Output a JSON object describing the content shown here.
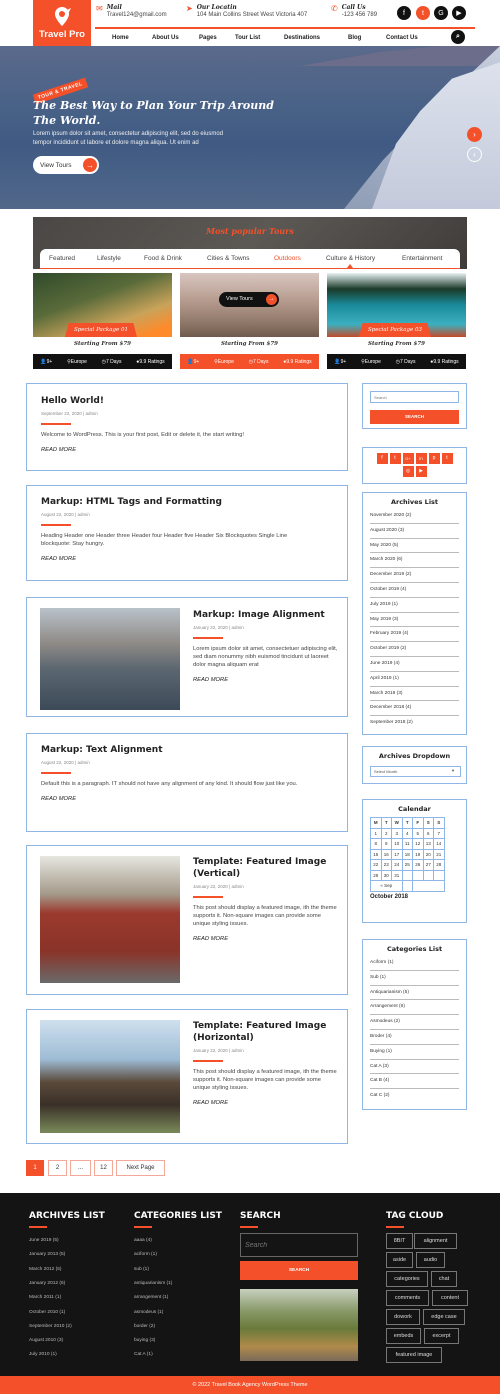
{
  "header": {
    "brand": "Travel Pro",
    "mail_label": "Mail",
    "mail_value": "Travel124@gmail.com",
    "location_label": "Our Locatin",
    "location_value": "104 Main Collins Street West Victoria 407",
    "call_label": "Call Us",
    "call_value": "-123 456 789",
    "social": [
      "facebook",
      "twitter",
      "google",
      "youtube"
    ],
    "nav": [
      "Home",
      "About Us",
      "Pages",
      "Tour List",
      "Destinations",
      "Blog",
      "Contact Us"
    ]
  },
  "hero": {
    "tag": "TOUR & TRAVEL",
    "title": "The Best Way to Plan Your Trip Around The World.",
    "text": "Lorem ipsum dolor sit amet, consectetur adipiscing elit, sed do eiusmod tempor incididunt ut labore et dolore magna aliqua. Ut enim ad",
    "button": "View Tours"
  },
  "tours": {
    "heading": "Most popular Tours",
    "tabs": [
      "Featured",
      "Lifestyle",
      "Food & Drink",
      "Cities & Towns",
      "Outdoors",
      "Culture & History",
      "Entertainment"
    ],
    "active_tab": "Outdoors",
    "cards": [
      {
        "package": "Special Package 01",
        "price": "Starting From $79",
        "people": "9+",
        "place": "Europe",
        "days": "7 Days",
        "rating": "9.9 Ratings"
      },
      {
        "package": "",
        "price": "Starting From $79",
        "people": "9+",
        "place": "Europe",
        "days": "7 Days",
        "rating": "9.9 Ratings",
        "hover_button": "View Tours"
      },
      {
        "package": "Special Package 03",
        "price": "Starting From $79",
        "people": "9+",
        "place": "Europe",
        "days": "7 Days",
        "rating": "9.9 Ratings"
      }
    ]
  },
  "posts": [
    {
      "title": "Hello World!",
      "meta": "September 22, 2020 | admin",
      "excerpt": "Welcome to WordPress. This is your first post, Edit or delete it, the start writing!",
      "more": "READ MORE"
    },
    {
      "title": "Markup: HTML Tags and Formatting",
      "meta": "August 22, 2020 | admin",
      "excerpt": "Heading Header one Header three Header four Header five Header Six Blockquotes Single Line blockquote: Stay hungry.",
      "more": "READ MORE"
    },
    {
      "title": "Markup: Image Alignment",
      "meta": "January 22, 2020 | admin",
      "excerpt": "Lorem ipsum dolor sit amet, consectetuer adipiscing elit, sed diam nonummy nibh euismod tincidunt ut laoreet dolor magna aliquam erat",
      "more": "READ MORE"
    },
    {
      "title": "Markup: Text Alignment",
      "meta": "August 22, 2020 | admin",
      "excerpt": "Default this is a paragraph. IT should not have any alignment of any kind. It should flow just like you.",
      "more": "READ MORE"
    },
    {
      "title": "Template: Featured Image (Vertical)",
      "meta": "January 22, 2020 | admin",
      "excerpt": "This post should display a featured image, ith the theme supports it. Non-square images can provide some unique styling issues.",
      "more": "READ MORE"
    },
    {
      "title": "Template: Featured Image (Horizontal)",
      "meta": "January 22, 2020 | admin",
      "excerpt": "This post should display a featured image, ith the theme supports it. Non-square images can provide some unique styling issues.",
      "more": "READ MORE"
    }
  ],
  "pagination": [
    "1",
    "2",
    "...",
    "12",
    "Next Page"
  ],
  "sidebar": {
    "search_placeholder": "Search",
    "search_button": "SEARCH",
    "social": [
      "f",
      "t",
      "G+",
      "in",
      "p",
      "t",
      "ig",
      "yt"
    ],
    "archives_title": "Archives List",
    "archives": [
      "November 2020 (2)",
      "August 2020 (3)",
      "May 2020 (5)",
      "March 2020 (6)",
      "December 2019 (2)",
      "October 2019 (4)",
      "July 2019 (1)",
      "May 2019 (3)",
      "February 2019 (4)",
      "October 2019 (2)",
      "June 2019 (4)",
      "April 2019 (1)",
      "March 2019 (3)",
      "December 2018 (4)",
      "September 2018 (2)"
    ],
    "dropdown_title": "Archives Dropdown",
    "dropdown_value": "Select Month",
    "calendar_title": "Calendar",
    "calendar_days": [
      "M",
      "T",
      "W",
      "T",
      "F",
      "S",
      "S"
    ],
    "calendar_weeks": [
      [
        "1",
        "2",
        "3",
        "4",
        "5",
        "6",
        "7"
      ],
      [
        "8",
        "9",
        "10",
        "11",
        "12",
        "13",
        "14"
      ],
      [
        "15",
        "16",
        "17",
        "18",
        "19",
        "20",
        "21"
      ],
      [
        "22",
        "23",
        "24",
        "25",
        "26",
        "27",
        "28"
      ],
      [
        "29",
        "30",
        "31",
        "",
        "",
        "",
        ""
      ]
    ],
    "calendar_prev": "« Sep",
    "calendar_caption": "October 2018",
    "categories_title": "Categories List",
    "categories": [
      "Aciform (1)",
      "Sub (1)",
      "Antiquarianism (5)",
      "Arrangement (6)",
      "Asmodeus (2)",
      "Broder (4)",
      "Buying (1)",
      "Cat A (3)",
      "Cat B (4)",
      "Cat C (2)"
    ]
  },
  "footer": {
    "archives_title": "ARCHIVES LIST",
    "archives": [
      "June 2019 (5)",
      "January 2013 (5)",
      "March 2012 (5)",
      "January 2012 (6)",
      "March 2011 (1)",
      "October 2010 (1)",
      "September 2010 (2)",
      "August 2010 (3)",
      "July 2010 (1)"
    ],
    "categories_title": "CATEGORIES LIST",
    "categories": [
      "aaaa (4)",
      "aciform (1)",
      "sub (1)",
      "antiquarianism (1)",
      "arrangement (1)",
      "asmodeus (1)",
      "border (2)",
      "buying (3)",
      "Cat A (1)"
    ],
    "search_title": "SEARCH",
    "search_placeholder": "Search",
    "search_button": "SEARCH",
    "tags_title": "TAG CLOUD",
    "tags": [
      "8BIT",
      "alignment",
      "aside",
      "audio",
      "categories",
      "chat",
      "comments",
      "content",
      "dowork",
      "edge case",
      "embeds",
      "excerpt",
      "featured image"
    ],
    "copyright": "© 2022 Travel Book Agency WordPress Theme"
  },
  "colors": {
    "accent": "#f4502a",
    "dark": "#141414",
    "border": "#8fb6e6"
  }
}
